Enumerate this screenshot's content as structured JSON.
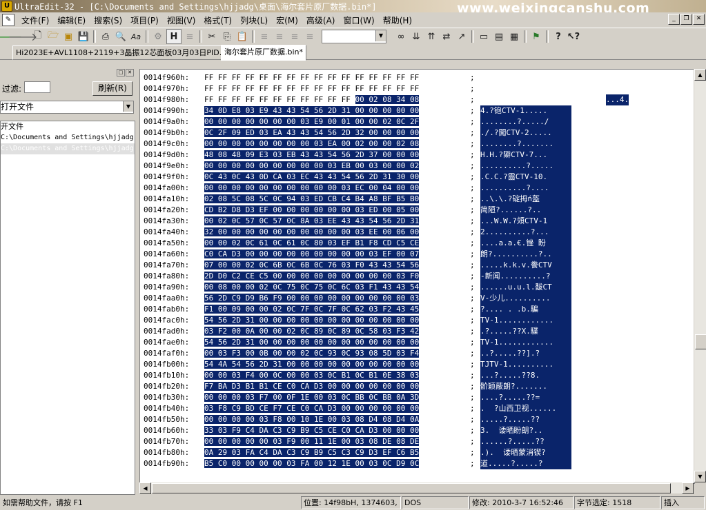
{
  "window": {
    "title": "UltraEdit-32 - [C:\\Documents and Settings\\hjjadg\\桌面\\海尔套片原厂数据.bin*]",
    "watermark": "www.weixingcanshu.com",
    "app_icon_letter": "U"
  },
  "menu": [
    "文件(F)",
    "编辑(E)",
    "搜索(S)",
    "项目(P)",
    "视图(V)",
    "格式(T)",
    "列块(L)",
    "宏(M)",
    "高级(A)",
    "窗口(W)",
    "帮助(H)"
  ],
  "toolbar": {
    "icons": [
      "back-arrow-icon",
      "forward-arrow-icon",
      "new-file-icon",
      "open-folder-icon",
      "open-icon",
      "save-icon",
      "print-icon",
      "print-preview-icon",
      "spell-check-icon",
      "find-icon",
      "hex-mode-icon",
      "word-wrap-icon",
      "cut-icon",
      "copy-icon",
      "paste-icon",
      "align-left-icon",
      "align-center-icon",
      "align-right-icon",
      "justify-icon"
    ],
    "right_icons": [
      "binoculars-icon",
      "find-next-icon",
      "find-prev-icon",
      "replace-icon",
      "goto-icon",
      "split-window-icon",
      "cascade-icon",
      "tile-icon",
      "ftp-icon",
      "help-icon",
      "context-help-icon"
    ]
  },
  "tabs": [
    "Hi2023E+AVL1108+2119+3晶振12芯面板03月03日PID.bin",
    "海尔套片原厂数据.bin*"
  ],
  "left_panel": {
    "filter_label": "过滤:",
    "refresh_label": "刷新(R)",
    "combo_value": "打开文件",
    "items": [
      "开文件",
      "C:\\Documents and Settings\\hjjadg",
      "C:\\Documents and Settings\\hjjadg"
    ]
  },
  "hex_rows": [
    {
      "addr": "0014f960h:",
      "bytes": "FF FF FF FF FF FF FF FF FF FF FF FF FF FF FF FF",
      "ascii": "",
      "sel": "none"
    },
    {
      "addr": "0014f970h:",
      "bytes": "FF FF FF FF FF FF FF FF FF FF FF FF FF FF FF FF",
      "ascii": "",
      "sel": "none"
    },
    {
      "addr": "0014f980h:",
      "bytes_pre": "FF FF FF FF FF FF FF FF FF FF FF ",
      "bytes_sel": "00 02 08 34 08",
      "ascii": "...4.",
      "sel": "partial"
    },
    {
      "addr": "0014f990h:",
      "bytes": "34 0D E8 03 E9 43 43 54 56 2D 31 00 00 00 00 00",
      "ascii": "4.?铇CTV-1.....",
      "sel": "full"
    },
    {
      "addr": "0014f9a0h:",
      "bytes": "00 00 00 00 00 00 00 03 E9 00 01 00 00 02 0C 2F",
      "ascii": "........?...../",
      "sel": "full"
    },
    {
      "addr": "0014f9b0h:",
      "bytes": "0C 2F 09 ED 03 EA 43 43 54 56 2D 32 00 00 00 00",
      "ascii": "./.?闖CTV-2.....",
      "sel": "full"
    },
    {
      "addr": "0014f9c0h:",
      "bytes": "00 00 00 00 00 00 00 00 03 EA 00 02 00 00 02 08",
      "ascii": "........?.......",
      "sel": "full"
    },
    {
      "addr": "0014f9d0h:",
      "bytes": "48 08 48 09 E3 03 EB 43 43 54 56 2D 37 00 00 00",
      "ascii": "H.H.?隦CTV-7...",
      "sel": "full"
    },
    {
      "addr": "0014f9e0h:",
      "bytes": "00 00 00 00 00 00 00 00 00 03 EB 00 03 00 00 02",
      "ascii": "..........?.....",
      "sel": "full"
    },
    {
      "addr": "0014f9f0h:",
      "bytes": "0C 43 0C 43 0D CA 03 EC 43 43 54 56 2D 31 30 00",
      "ascii": ".C.C.?霝CTV-10.",
      "sel": "full"
    },
    {
      "addr": "0014fa00h:",
      "bytes": "00 00 00 00 00 00 00 00 00 00 03 EC 00 04 00 00",
      "ascii": "..........?....",
      "sel": "full"
    },
    {
      "addr": "0014fa10h:",
      "bytes": "02 08 5C 08 5C 0C 94 03 ED CB C4 B4 A8 BF B5 B0",
      "ascii": "..\\.\\.?碇拇ń盔",
      "sel": "full"
    },
    {
      "addr": "0014fa20h:",
      "bytes": "CD B2 D8 D3 EF 00 00 00 00 00 00 03 ED 00 05 00",
      "ascii": "简陋?......?..",
      "sel": "full"
    },
    {
      "addr": "0014fa30h:",
      "bytes": "00 02 0C 57 0C 57 0C 8A 03 EE 43 43 54 56 2D 31",
      "ascii": "...W.W.?頝CTV-1",
      "sel": "full"
    },
    {
      "addr": "0014fa40h:",
      "bytes": "32 00 00 00 00 00 00 00 00 00 00 03 EE 00 06 00",
      "ascii": "2..........?...",
      "sel": "full"
    },
    {
      "addr": "0014fa50h:",
      "bytes": "00 00 02 0C 61 0C 61 0C 80 03 EF B1 F8 CD C5 CE",
      "ascii": "....a.a.€.锉 盼",
      "sel": "full"
    },
    {
      "addr": "0014fa60h:",
      "bytes": "C0 CA D3 00 00 00 00 00 00 00 00 00 03 EF 00 07",
      "ascii": "朗?..........?..",
      "sel": "full"
    },
    {
      "addr": "0014fa70h:",
      "bytes": "07 00 00 02 0C 6B 0C 6B 0C 76 03 F0 43 43 54 56",
      "ascii": ".....k.k.v.餋CTV",
      "sel": "full"
    },
    {
      "addr": "0014fa80h:",
      "bytes": "2D D0 C2 CE C5 00 00 00 00 00 00 00 00 00 03 F0",
      "ascii": "-新闻..........?",
      "sel": "full"
    },
    {
      "addr": "0014fa90h:",
      "bytes": "00 08 00 00 02 0C 75 0C 75 0C 6C 03 F1 43 43 54",
      "ascii": "......u.u.l.馛CT",
      "sel": "full"
    },
    {
      "addr": "0014faa0h:",
      "bytes": "56 2D C9 D9 B6 F9 00 00 00 00 00 00 00 00 00 03",
      "ascii": "V-少儿..........",
      "sel": "full"
    },
    {
      "addr": "0014fab0h:",
      "bytes": "F1 00 09 00 00 02 0C 7F 0C 7F 0C 62 03 F2 43 45",
      "ascii": "?.... . .b.騙",
      "sel": "full"
    },
    {
      "addr": "0014fac0h:",
      "bytes": "54 56 2D 31 00 00 00 00 00 00 00 00 00 00 00 00",
      "ascii": "TV-1............",
      "sel": "full"
    },
    {
      "addr": "0014fad0h:",
      "bytes": "03 F2 00 0A 00 00 02 0C 89 0C 89 0C 58 03 F3 42",
      "ascii": ".?.....??X.驜",
      "sel": "full"
    },
    {
      "addr": "0014fae0h:",
      "bytes": "54 56 2D 31 00 00 00 00 00 00 00 00 00 00 00 00",
      "ascii": "TV-1............",
      "sel": "full"
    },
    {
      "addr": "0014faf0h:",
      "bytes": "00 03 F3 00 0B 00 00 02 0C 93 0C 93 08 5D 03 F4",
      "ascii": "..?.....??].?",
      "sel": "full"
    },
    {
      "addr": "0014fb00h:",
      "bytes": "54 4A 54 56 2D 31 00 00 00 00 00 00 00 00 00 00",
      "ascii": "TJTV-1..........",
      "sel": "full"
    },
    {
      "addr": "0014fb10h:",
      "bytes": "00 00 03 F4 00 0C 00 00 03 0C B1 0C B1 0E 38 03",
      "ascii": "...?.....??8.",
      "sel": "full"
    },
    {
      "addr": "0014fb20h:",
      "bytes": "F7 BA D3 B1 B1 CE C0 CA D3 00 00 00 00 00 00 00",
      "ascii": "骱颖蔽朗?.......",
      "sel": "full"
    },
    {
      "addr": "0014fb30h:",
      "bytes": "00 00 00 03 F7 00 0F 1E 00 03 0C BB 0C BB 0A 3D",
      "ascii": "....?.....??=",
      "sel": "full"
    },
    {
      "addr": "0014fb40h:",
      "bytes": "03 F8 C9 BD CE F7 CE C0 CA D3 00 00 00 00 00 00",
      "ascii": ".  ?山西卫视......",
      "sel": "full"
    },
    {
      "addr": "0014fb50h:",
      "bytes": "00 00 00 00 03 F8 00 10 1E 00 03 08 D4 08 D4 0A",
      "ascii": ".....?.....??",
      "sel": "full"
    },
    {
      "addr": "0014fb60h:",
      "bytes": "33 03 F9 C4 DA C3 C9 B9 C5 CE C0 CA D3 00 00 00",
      "ascii": "3.  诿晒盼朗?..",
      "sel": "full"
    },
    {
      "addr": "0014fb70h:",
      "bytes": "00 00 00 00 00 03 F9 00 11 1E 00 03 08 DE 08 DE",
      "ascii": "......?.....??",
      "sel": "full"
    },
    {
      "addr": "0014fb80h:",
      "bytes": "0A 29 03 FA C4 DA C3 C9 B9 C5 C3 C9 D3 EF C6 B5",
      "ascii": ".).  诿晒蒙消锲?",
      "sel": "full"
    },
    {
      "addr": "0014fb90h:",
      "bytes_sel": "B5 C0 00 00 00 00 03 FA 00 12 1E 00 03 0C D9 0C",
      "ascii": "道.....?.....?",
      "sel": "full"
    }
  ],
  "status": {
    "help": "如需帮助文件，请按 F1",
    "position": "位置: 14f98bH, 1374603,",
    "mode": "DOS",
    "modified": "修改: 2010-3-7 16:52:46",
    "selection": "字节选定: 1518",
    "insert": "插入"
  }
}
